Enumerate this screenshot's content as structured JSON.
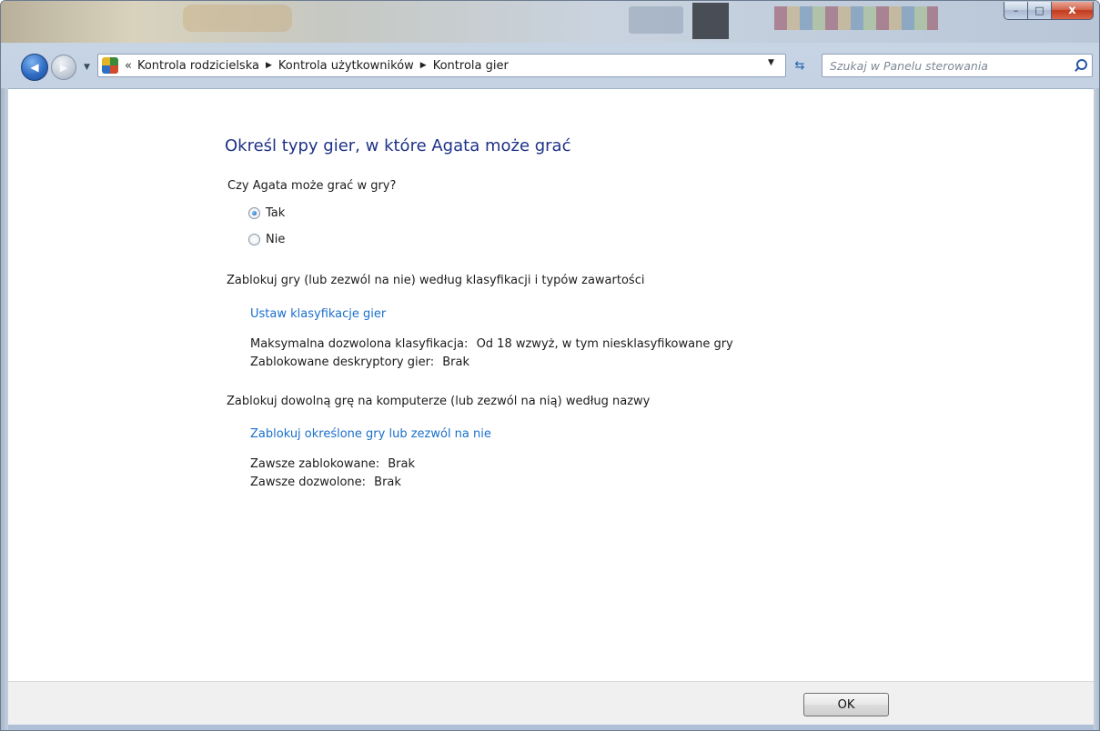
{
  "window": {
    "caption_minimize": "–",
    "caption_maximize": "□",
    "caption_close": "x"
  },
  "nav": {
    "back_glyph": "◀",
    "forward_glyph": "▶",
    "dropdown_glyph": "▼"
  },
  "address": {
    "chevron": "«",
    "crumbs": [
      "Kontrola rodzicielska",
      "Kontrola użytkowników",
      "Kontrola gier"
    ],
    "separator": "▶",
    "dropdown_glyph": "▼",
    "refresh_glyph": "⇆"
  },
  "search": {
    "placeholder": "Szukaj w Panelu sterowania"
  },
  "main": {
    "title": "Określ typy gier, w które Agata może grać",
    "question": "Czy Agata może grać w gry?",
    "radio_yes": "Tak",
    "radio_no": "Nie",
    "selected": "Tak",
    "section1_heading": "Zablokuj gry (lub zezwól na nie) według klasyfikacji i typów zawartości",
    "section1_link": "Ustaw klasyfikacje gier",
    "max_rating_label": "Maksymalna dozwolona klasyfikacja:",
    "max_rating_value": "Od 18 wzwyż, w tym niesklasyfikowane gry",
    "blocked_desc_label": "Zablokowane deskryptory gier:",
    "blocked_desc_value": "Brak",
    "section2_heading": "Zablokuj dowolną grę na komputerze (lub zezwól na nią) według nazwy",
    "section2_link": "Zablokuj określone gry lub zezwól na nie",
    "always_blocked_label": "Zawsze zablokowane:",
    "always_blocked_value": "Brak",
    "always_allowed_label": "Zawsze dozwolone:",
    "always_allowed_value": "Brak"
  },
  "footer": {
    "ok_label": "OK"
  },
  "colors": {
    "title_blue": "#1e3287",
    "link_blue": "#1a6fcb",
    "close_red": "#c0391d"
  }
}
